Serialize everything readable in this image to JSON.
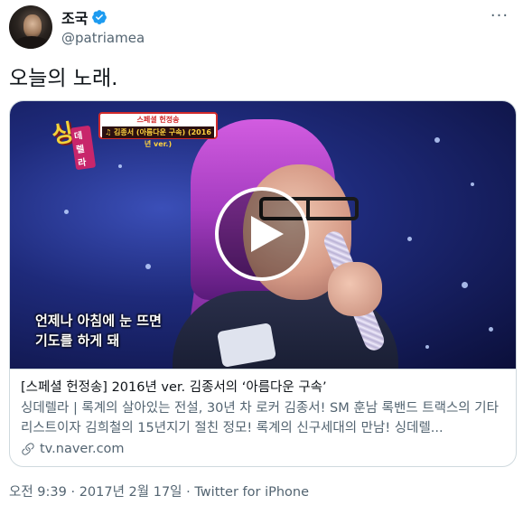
{
  "author": {
    "display_name": "조국",
    "handle": "@patriamea",
    "verified": true
  },
  "tweet": {
    "text": "오늘의 노래."
  },
  "media": {
    "show_logo_text": "싱",
    "show_logo_sub": "데렐라",
    "caption_top": "스페셜 헌정송",
    "caption_bottom": "♫ 김종서 (아름다운 구속) (2016년 ver.)",
    "subtitle_line1": "언제나 아침에 눈 뜨면",
    "subtitle_line2": "기도를 하게 돼"
  },
  "card": {
    "title": "[스페셜 헌정송] 2016년 ver. 김종서의 ‘아름다운 구속’",
    "description": "싱데렐라 | 록계의 살아있는 전설, 30년 차 로커 김종서! SM 훈남 록밴드 트랙스의 기타리스트이자 김희철의 15년지기 절친 정모! 록계의 신구세대의 만남! 싱데렐...",
    "domain": "tv.naver.com"
  },
  "meta": {
    "time": "오전 9:39",
    "separator1": " · ",
    "date": "2017년 2월 17일",
    "separator2": " · ",
    "source": "Twitter for iPhone"
  },
  "colors": {
    "verified_blue": "#1d9bf0",
    "text_primary": "#0f1419",
    "text_secondary": "#536471",
    "border": "#cfd9de"
  }
}
